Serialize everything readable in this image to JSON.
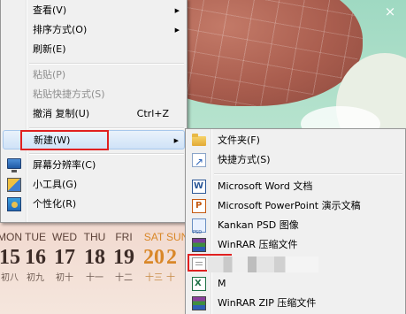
{
  "desktop": {
    "close_glyph": "×",
    "calendar": {
      "days": [
        {
          "dow": "MON",
          "day": "15",
          "lunar": "初八",
          "weekend": false
        },
        {
          "dow": "TUE",
          "day": "16",
          "lunar": "初九",
          "weekend": false
        },
        {
          "dow": "WED",
          "day": "17",
          "lunar": "初十",
          "weekend": false
        },
        {
          "dow": "THU",
          "day": "18",
          "lunar": "十一",
          "weekend": false
        },
        {
          "dow": "FRI",
          "day": "19",
          "lunar": "十二",
          "weekend": false
        },
        {
          "dow": "SAT",
          "day": "20",
          "lunar": "十三",
          "weekend": true
        },
        {
          "dow": "SUN",
          "day": "2",
          "lunar": "十",
          "weekend": true
        }
      ]
    }
  },
  "context_menu": {
    "items": [
      {
        "label": "查看(V)",
        "has_submenu": true,
        "disabled": false
      },
      {
        "label": "排序方式(O)",
        "has_submenu": true,
        "disabled": false
      },
      {
        "label": "刷新(E)",
        "has_submenu": false,
        "disabled": false
      },
      {
        "label": "粘贴(P)",
        "has_submenu": false,
        "disabled": true
      },
      {
        "label": "粘贴快捷方式(S)",
        "has_submenu": false,
        "disabled": true
      },
      {
        "label": "撤消 复制(U)",
        "shortcut": "Ctrl+Z",
        "has_submenu": false,
        "disabled": false
      },
      {
        "label": "新建(W)",
        "has_submenu": true,
        "disabled": false,
        "highlighted": true
      },
      {
        "label": "屏幕分辨率(C)",
        "icon": "screen-resolution-icon",
        "has_submenu": false,
        "disabled": false
      },
      {
        "label": "小工具(G)",
        "icon": "gadgets-icon",
        "has_submenu": false,
        "disabled": false
      },
      {
        "label": "个性化(R)",
        "icon": "personalize-icon",
        "has_submenu": false,
        "disabled": false
      }
    ]
  },
  "new_submenu": {
    "items": [
      {
        "label": "文件夹(F)",
        "icon": "folder-icon"
      },
      {
        "label": "快捷方式(S)",
        "icon": "shortcut-icon"
      },
      {
        "label": "Microsoft Word 文档",
        "icon": "word-document-icon"
      },
      {
        "label": "Microsoft PowerPoint 演示文稿",
        "icon": "powerpoint-presentation-icon"
      },
      {
        "label": "Kankan PSD 图像",
        "icon": "psd-image-icon"
      },
      {
        "label": "WinRAR 压缩文件",
        "icon": "winrar-archive-icon"
      },
      {
        "label": "文",
        "icon": "text-document-icon"
      },
      {
        "label": "M",
        "icon": "excel-worksheet-icon"
      },
      {
        "label": "WinRAR ZIP 压缩文件",
        "icon": "winrar-zip-icon"
      }
    ]
  },
  "colors": {
    "callout": "#e02020",
    "menu_bg": "#f0f0f0",
    "highlight": "#cfe2f7",
    "weekend": "#d98728"
  }
}
